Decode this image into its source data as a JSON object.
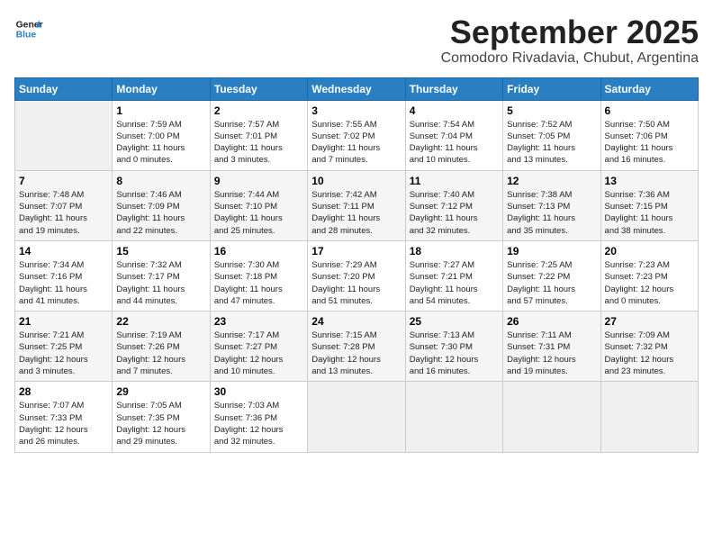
{
  "header": {
    "logo_line1": "General",
    "logo_line2": "Blue",
    "month": "September 2025",
    "location": "Comodoro Rivadavia, Chubut, Argentina"
  },
  "weekdays": [
    "Sunday",
    "Monday",
    "Tuesday",
    "Wednesday",
    "Thursday",
    "Friday",
    "Saturday"
  ],
  "weeks": [
    [
      {
        "day": "",
        "info": ""
      },
      {
        "day": "1",
        "info": "Sunrise: 7:59 AM\nSunset: 7:00 PM\nDaylight: 11 hours\nand 0 minutes."
      },
      {
        "day": "2",
        "info": "Sunrise: 7:57 AM\nSunset: 7:01 PM\nDaylight: 11 hours\nand 3 minutes."
      },
      {
        "day": "3",
        "info": "Sunrise: 7:55 AM\nSunset: 7:02 PM\nDaylight: 11 hours\nand 7 minutes."
      },
      {
        "day": "4",
        "info": "Sunrise: 7:54 AM\nSunset: 7:04 PM\nDaylight: 11 hours\nand 10 minutes."
      },
      {
        "day": "5",
        "info": "Sunrise: 7:52 AM\nSunset: 7:05 PM\nDaylight: 11 hours\nand 13 minutes."
      },
      {
        "day": "6",
        "info": "Sunrise: 7:50 AM\nSunset: 7:06 PM\nDaylight: 11 hours\nand 16 minutes."
      }
    ],
    [
      {
        "day": "7",
        "info": "Sunrise: 7:48 AM\nSunset: 7:07 PM\nDaylight: 11 hours\nand 19 minutes."
      },
      {
        "day": "8",
        "info": "Sunrise: 7:46 AM\nSunset: 7:09 PM\nDaylight: 11 hours\nand 22 minutes."
      },
      {
        "day": "9",
        "info": "Sunrise: 7:44 AM\nSunset: 7:10 PM\nDaylight: 11 hours\nand 25 minutes."
      },
      {
        "day": "10",
        "info": "Sunrise: 7:42 AM\nSunset: 7:11 PM\nDaylight: 11 hours\nand 28 minutes."
      },
      {
        "day": "11",
        "info": "Sunrise: 7:40 AM\nSunset: 7:12 PM\nDaylight: 11 hours\nand 32 minutes."
      },
      {
        "day": "12",
        "info": "Sunrise: 7:38 AM\nSunset: 7:13 PM\nDaylight: 11 hours\nand 35 minutes."
      },
      {
        "day": "13",
        "info": "Sunrise: 7:36 AM\nSunset: 7:15 PM\nDaylight: 11 hours\nand 38 minutes."
      }
    ],
    [
      {
        "day": "14",
        "info": "Sunrise: 7:34 AM\nSunset: 7:16 PM\nDaylight: 11 hours\nand 41 minutes."
      },
      {
        "day": "15",
        "info": "Sunrise: 7:32 AM\nSunset: 7:17 PM\nDaylight: 11 hours\nand 44 minutes."
      },
      {
        "day": "16",
        "info": "Sunrise: 7:30 AM\nSunset: 7:18 PM\nDaylight: 11 hours\nand 47 minutes."
      },
      {
        "day": "17",
        "info": "Sunrise: 7:29 AM\nSunset: 7:20 PM\nDaylight: 11 hours\nand 51 minutes."
      },
      {
        "day": "18",
        "info": "Sunrise: 7:27 AM\nSunset: 7:21 PM\nDaylight: 11 hours\nand 54 minutes."
      },
      {
        "day": "19",
        "info": "Sunrise: 7:25 AM\nSunset: 7:22 PM\nDaylight: 11 hours\nand 57 minutes."
      },
      {
        "day": "20",
        "info": "Sunrise: 7:23 AM\nSunset: 7:23 PM\nDaylight: 12 hours\nand 0 minutes."
      }
    ],
    [
      {
        "day": "21",
        "info": "Sunrise: 7:21 AM\nSunset: 7:25 PM\nDaylight: 12 hours\nand 3 minutes."
      },
      {
        "day": "22",
        "info": "Sunrise: 7:19 AM\nSunset: 7:26 PM\nDaylight: 12 hours\nand 7 minutes."
      },
      {
        "day": "23",
        "info": "Sunrise: 7:17 AM\nSunset: 7:27 PM\nDaylight: 12 hours\nand 10 minutes."
      },
      {
        "day": "24",
        "info": "Sunrise: 7:15 AM\nSunset: 7:28 PM\nDaylight: 12 hours\nand 13 minutes."
      },
      {
        "day": "25",
        "info": "Sunrise: 7:13 AM\nSunset: 7:30 PM\nDaylight: 12 hours\nand 16 minutes."
      },
      {
        "day": "26",
        "info": "Sunrise: 7:11 AM\nSunset: 7:31 PM\nDaylight: 12 hours\nand 19 minutes."
      },
      {
        "day": "27",
        "info": "Sunrise: 7:09 AM\nSunset: 7:32 PM\nDaylight: 12 hours\nand 23 minutes."
      }
    ],
    [
      {
        "day": "28",
        "info": "Sunrise: 7:07 AM\nSunset: 7:33 PM\nDaylight: 12 hours\nand 26 minutes."
      },
      {
        "day": "29",
        "info": "Sunrise: 7:05 AM\nSunset: 7:35 PM\nDaylight: 12 hours\nand 29 minutes."
      },
      {
        "day": "30",
        "info": "Sunrise: 7:03 AM\nSunset: 7:36 PM\nDaylight: 12 hours\nand 32 minutes."
      },
      {
        "day": "",
        "info": ""
      },
      {
        "day": "",
        "info": ""
      },
      {
        "day": "",
        "info": ""
      },
      {
        "day": "",
        "info": ""
      }
    ]
  ]
}
